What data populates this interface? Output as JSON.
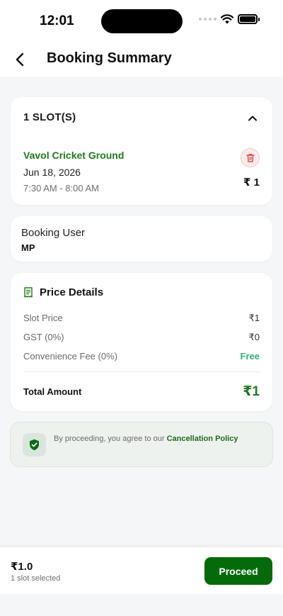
{
  "status_bar": {
    "time": "12:01"
  },
  "header": {
    "title": "Booking Summary"
  },
  "slot_card": {
    "count_label": "1 SLOT(S)",
    "venue": "Vavol Cricket Ground",
    "date": "Jun 18, 2026",
    "time_range": "7:30 AM - 8:00 AM",
    "price": "₹ 1"
  },
  "user_card": {
    "label": "Booking User",
    "value": "MP"
  },
  "price_details": {
    "title": "Price Details",
    "rows": [
      {
        "label": "Slot Price",
        "value": "₹1"
      },
      {
        "label": "GST (0%)",
        "value": "₹0"
      },
      {
        "label": "Convenience Fee (0%)",
        "value": "Free"
      }
    ],
    "total_label": "Total Amount",
    "total_value": "₹1"
  },
  "policy": {
    "text": "By proceeding, you agree to our ",
    "link": "Cancellation Policy"
  },
  "bottom_bar": {
    "total": "₹1.0",
    "subtext": "1 slot selected",
    "proceed_label": "Proceed"
  },
  "colors": {
    "accent_green": "#1e7a1e",
    "button_green": "#056b0a",
    "free_green": "#2bb673",
    "delete_red": "#e04848"
  }
}
